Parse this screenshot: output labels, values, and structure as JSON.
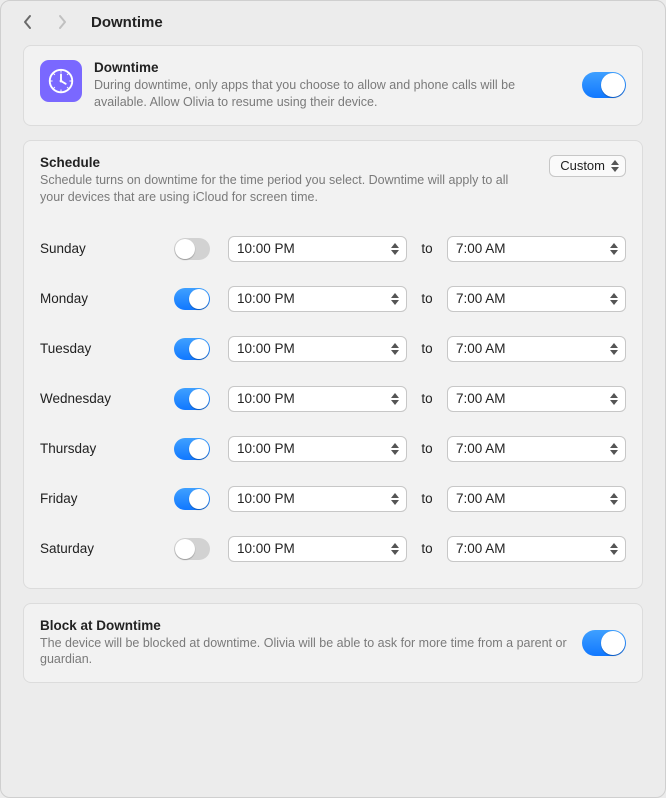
{
  "nav": {
    "back_enabled": true,
    "forward_enabled": false,
    "title": "Downtime"
  },
  "header": {
    "title": "Downtime",
    "description": "During downtime, only apps that you choose to allow and phone calls will be available. Allow Olivia to resume using their device.",
    "toggle_on": true,
    "icon": "clock-icon"
  },
  "schedule": {
    "title": "Schedule",
    "description": "Schedule turns on downtime for the time period you select. Downtime will apply to all your devices that are using iCloud for screen time.",
    "mode_label": "Custom",
    "to_label": "to",
    "days": [
      {
        "name": "Sunday",
        "enabled": false,
        "start": "10:00 PM",
        "end": "7:00 AM"
      },
      {
        "name": "Monday",
        "enabled": true,
        "start": "10:00 PM",
        "end": "7:00 AM"
      },
      {
        "name": "Tuesday",
        "enabled": true,
        "start": "10:00 PM",
        "end": "7:00 AM"
      },
      {
        "name": "Wednesday",
        "enabled": true,
        "start": "10:00 PM",
        "end": "7:00 AM"
      },
      {
        "name": "Thursday",
        "enabled": true,
        "start": "10:00 PM",
        "end": "7:00 AM"
      },
      {
        "name": "Friday",
        "enabled": true,
        "start": "10:00 PM",
        "end": "7:00 AM"
      },
      {
        "name": "Saturday",
        "enabled": false,
        "start": "10:00 PM",
        "end": "7:00 AM"
      }
    ]
  },
  "block": {
    "title": "Block at Downtime",
    "description": "The device will be blocked at downtime. Olivia will be able to ask for more time from a parent or guardian.",
    "toggle_on": true
  },
  "colors": {
    "accent": "#0a84ff",
    "app_icon_bg": "#7a68ff",
    "muted": "#7a7a7a"
  }
}
